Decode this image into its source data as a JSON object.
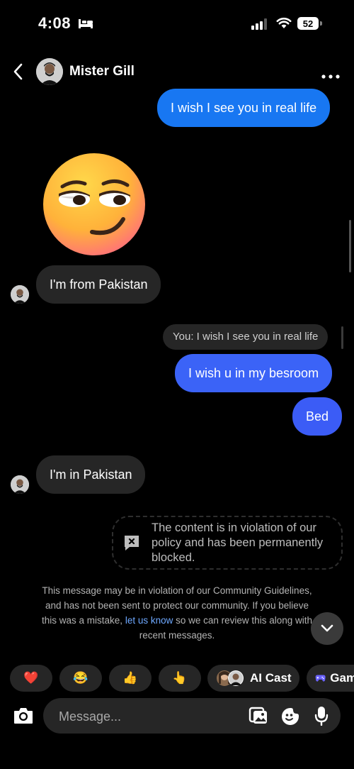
{
  "status_bar": {
    "time": "4:08",
    "battery": "52"
  },
  "header": {
    "contact_name": "Mister Gill"
  },
  "messages": {
    "out_1": "I wish I see you in real life",
    "in_1": "I'm from Pakistan",
    "reply_preview": "You: I wish I see you in real life",
    "out_2": "I wish u in my besroom",
    "out_3": "Bed",
    "in_2": "I'm in Pakistan"
  },
  "blocked_notice": "The content is in violation of our policy and has been permanently blocked.",
  "guideline": {
    "text_1": "This message may be in violation of our Community Guidelines, and has not been sent to protect our community. If you believe this was a mistake,",
    "link": "let us know",
    "text_2": "so we can review this along with recent messages."
  },
  "quick_replies": {
    "heart": "❤️",
    "joy": "😂",
    "thumbs_up": "👍",
    "point": "👆",
    "ai_cast": "AI Cast",
    "games": "Games"
  },
  "composer": {
    "placeholder": "Message..."
  },
  "colors": {
    "outgoing": "#1877f2",
    "outgoing_alt": "#3b5cf6",
    "incoming": "#262626",
    "link": "#6ea8ff"
  }
}
